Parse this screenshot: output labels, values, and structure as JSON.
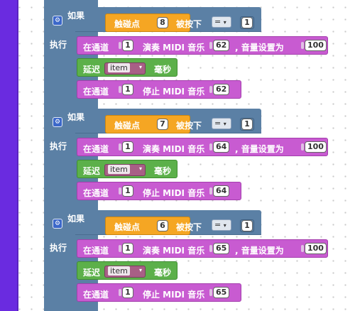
{
  "blocks": [
    {
      "if_label": "如果",
      "do_label": "执行",
      "condition": {
        "prefix": "触碰点",
        "touch_point": "8",
        "suffix": "被按下",
        "operator": "=",
        "compare_value": "1"
      },
      "play": {
        "channel_label": "在通道",
        "channel": "1",
        "action": "演奏 MIDI 音乐",
        "note": "62",
        "volume_label": ", 音量设置为",
        "volume": "100"
      },
      "delay": {
        "label": "延迟",
        "variable": "item",
        "unit": "毫秒"
      },
      "stop": {
        "channel_label": "在通道",
        "channel": "1",
        "action": "停止 MIDI 音乐",
        "note": "62"
      }
    },
    {
      "if_label": "如果",
      "do_label": "执行",
      "condition": {
        "prefix": "触碰点",
        "touch_point": "7",
        "suffix": "被按下",
        "operator": "=",
        "compare_value": "1"
      },
      "play": {
        "channel_label": "在通道",
        "channel": "1",
        "action": "演奏 MIDI 音乐",
        "note": "64",
        "volume_label": ", 音量设置为",
        "volume": "100"
      },
      "delay": {
        "label": "延迟",
        "variable": "item",
        "unit": "毫秒"
      },
      "stop": {
        "channel_label": "在通道",
        "channel": "1",
        "action": "停止 MIDI 音乐",
        "note": "64"
      }
    },
    {
      "if_label": "如果",
      "do_label": "执行",
      "condition": {
        "prefix": "触碰点",
        "touch_point": "6",
        "suffix": "被按下",
        "operator": "=",
        "compare_value": "1"
      },
      "play": {
        "channel_label": "在通道",
        "channel": "1",
        "action": "演奏 MIDI 音乐",
        "note": "65",
        "volume_label": ", 音量设置为",
        "volume": "100"
      },
      "delay": {
        "label": "延迟",
        "variable": "item",
        "unit": "毫秒"
      },
      "stop": {
        "channel_label": "在通道",
        "channel": "1",
        "action": "停止 MIDI 音乐",
        "note": "65"
      }
    }
  ],
  "icons": {
    "gear": "gear-icon",
    "dropdown": "chevron-down-icon"
  },
  "colors": {
    "sidebar": "#6a2be0",
    "if_block": "#5b80a5",
    "touch": "#f5a623",
    "midi": "#c85bd1",
    "delay": "#5cb04a",
    "variable": "#a85f86"
  }
}
